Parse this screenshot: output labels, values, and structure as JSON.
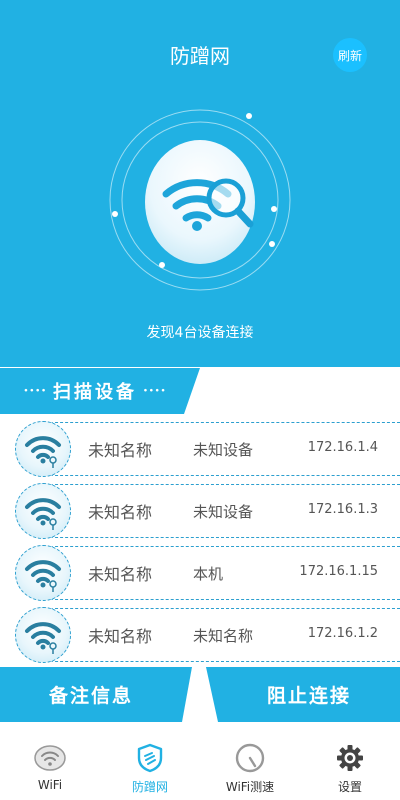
{
  "header": {
    "title": "防蹭网",
    "refresh_label": "刷新",
    "status": "发现4台设备连接"
  },
  "scan_section": {
    "title": "扫描设备",
    "dots_left": "····",
    "dots_right": "····"
  },
  "devices": [
    {
      "name": "未知名称",
      "type": "未知设备",
      "ip": "172.16.1.4"
    },
    {
      "name": "未知名称",
      "type": "未知设备",
      "ip": "172.16.1.3"
    },
    {
      "name": "未知名称",
      "type": "本机",
      "ip": "172.16.1.15"
    },
    {
      "name": "未知名称",
      "type": "未知名称",
      "ip": "172.16.1.2"
    }
  ],
  "actions": {
    "remark_label": "备注信息",
    "block_label": "阻止连接"
  },
  "nav": {
    "items": [
      {
        "label": "WiFi",
        "icon": "wifi-badge-icon",
        "active": false
      },
      {
        "label": "防蹭网",
        "icon": "shield-icon",
        "active": true
      },
      {
        "label": "WiFi测速",
        "icon": "speed-gauge-icon",
        "active": false
      },
      {
        "label": "设置",
        "icon": "gear-icon",
        "active": false
      }
    ]
  },
  "colors": {
    "primary": "#21b1e3",
    "accent": "#1bc0ff",
    "row_line": "#2c9fcf",
    "wifi_icon": "#2a7fa0"
  }
}
